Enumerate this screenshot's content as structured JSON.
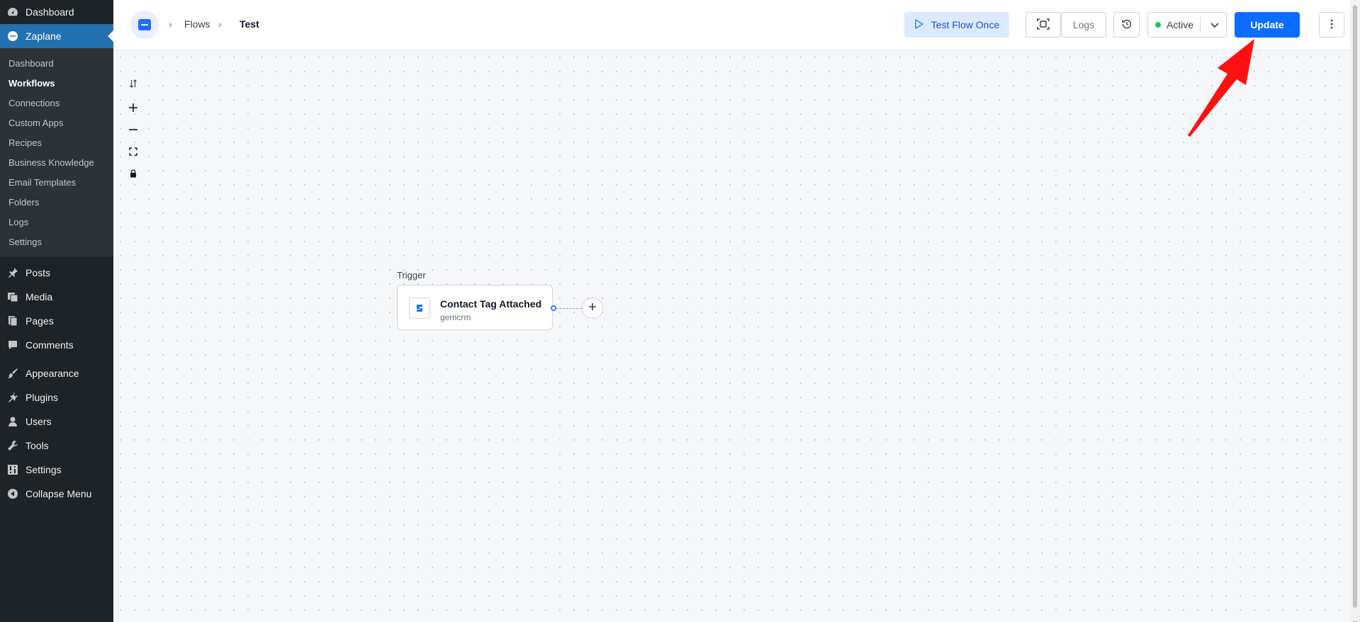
{
  "wp_menu": {
    "top": [
      {
        "label": "Dashboard",
        "icon": "dashboard-icon"
      },
      {
        "label": "Zaplane",
        "icon": "zaplane-icon"
      }
    ],
    "zaplane_submenu": [
      {
        "label": "Dashboard"
      },
      {
        "label": "Workflows"
      },
      {
        "label": "Connections"
      },
      {
        "label": "Custom Apps"
      },
      {
        "label": "Recipes"
      },
      {
        "label": "Business Knowledge"
      },
      {
        "label": "Email Templates"
      },
      {
        "label": "Folders"
      },
      {
        "label": "Logs"
      },
      {
        "label": "Settings"
      }
    ],
    "bottom": [
      {
        "label": "Posts",
        "icon": "pin-icon"
      },
      {
        "label": "Media",
        "icon": "media-icon"
      },
      {
        "label": "Pages",
        "icon": "pages-icon"
      },
      {
        "label": "Comments",
        "icon": "comment-icon"
      },
      {
        "label": "Appearance",
        "icon": "brush-icon"
      },
      {
        "label": "Plugins",
        "icon": "plugin-icon"
      },
      {
        "label": "Users",
        "icon": "user-icon"
      },
      {
        "label": "Tools",
        "icon": "wrench-icon"
      },
      {
        "label": "Settings",
        "icon": "settings-icon"
      },
      {
        "label": "Collapse Menu",
        "icon": "collapse-icon"
      }
    ],
    "current": "Zaplane",
    "active_sub": "Workflows"
  },
  "breadcrumb": {
    "items": [
      "Flows",
      "Test"
    ]
  },
  "toolbar": {
    "test_flow_label": "Test Flow Once",
    "logs_label": "Logs",
    "status_label": "Active",
    "update_label": "Update"
  },
  "canvas": {
    "trigger_label": "Trigger",
    "node_title": "Contact Tag Attached",
    "node_subtitle": "gemcrm"
  },
  "colors": {
    "accent": "#0b6cff",
    "status_active": "#22c55e",
    "annotation": "#ff0000"
  }
}
